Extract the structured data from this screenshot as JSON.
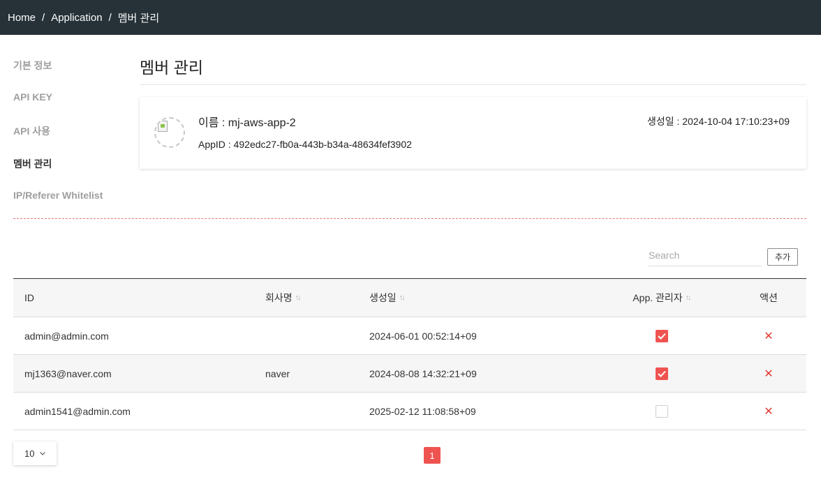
{
  "breadcrumb": {
    "home": "Home",
    "application": "Application",
    "current": "멤버 관리",
    "separator": "/"
  },
  "sidebar": {
    "items": [
      {
        "label": "기본 정보",
        "active": false
      },
      {
        "label": "API KEY",
        "active": false
      },
      {
        "label": "API 사용",
        "active": false
      },
      {
        "label": "멤버 관리",
        "active": true
      },
      {
        "label": "IP/Referer Whitelist",
        "active": false
      }
    ]
  },
  "page": {
    "title": "멤버 관리"
  },
  "app": {
    "name_line": "이름 : mj-aws-app-2",
    "id_line": "AppID : 492edc27-fb0a-443b-b34a-48634fef3902",
    "created_line": "생성일 : 2024-10-04 17:10:23+09"
  },
  "toolbar": {
    "search_placeholder": "Search",
    "search_value": "",
    "add_label": "추가"
  },
  "table": {
    "columns": {
      "id": "ID",
      "company": "회사명",
      "created": "생성일",
      "admin": "App. 관리자",
      "action": "액션"
    },
    "sort_icon": "↑↓",
    "rows": [
      {
        "id": "admin@admin.com",
        "company": "",
        "created": "2024-06-01 00:52:14+09",
        "admin": true
      },
      {
        "id": "mj1363@naver.com",
        "company": "naver",
        "created": "2024-08-08 14:32:21+09",
        "admin": true
      },
      {
        "id": "admin1541@admin.com",
        "company": "",
        "created": "2025-02-12 11:08:58+09",
        "admin": false
      }
    ]
  },
  "pagination": {
    "page_size": "10",
    "current_page": "1"
  },
  "icons": {
    "sort": "sort-arrows-icon",
    "delete": "close-x-icon",
    "check": "checkmark-icon",
    "chevron": "chevron-down-icon"
  },
  "colors": {
    "topbar": "#263238",
    "accent": "#ef5350",
    "delete": "#e53935"
  }
}
